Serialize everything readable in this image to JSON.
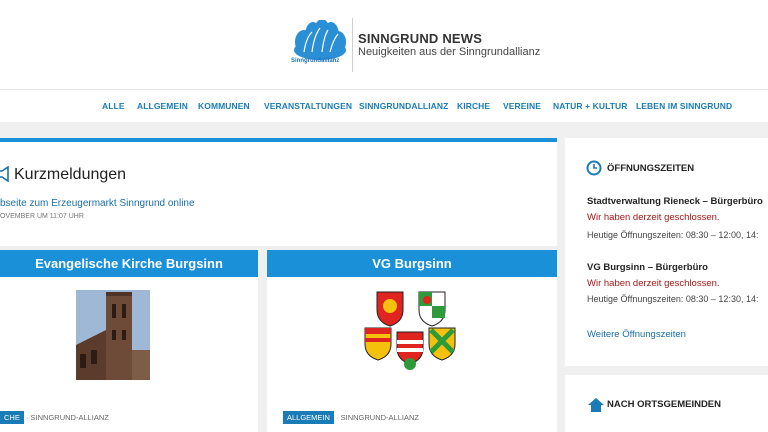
{
  "header": {
    "logo_text": "Sinngrundallianz",
    "title": "SINNGRUND NEWS",
    "subtitle": "Neuigkeiten aus der Sinngrundallianz"
  },
  "nav": {
    "items": [
      "ALLE",
      "ALLGEMEIN",
      "KOMMUNEN",
      "VERANSTALTUNGEN",
      "SINNGRUNDALLIANZ",
      "KIRCHE",
      "VEREINE",
      "NATUR + KULTUR",
      "LEBEN IM SINNGRUND"
    ]
  },
  "news": {
    "title": "Kurzmeldungen",
    "link": "bseite zum Erzeugermarkt Sinngrund online",
    "date": "OVEMBER UM 11:07 UHR"
  },
  "cards": [
    {
      "title": "Evangelische Kirche Burgsinn",
      "tag": "CHE",
      "category": "SINNGRUND-ALLIANZ"
    },
    {
      "title": "VG Burgsinn",
      "tag": "ALLGEMEIN",
      "category": "SINNGRUND-ALLIANZ"
    }
  ],
  "sidebar": {
    "hours_title": "ÖFFNUNGSZEITEN",
    "offices": [
      {
        "name": "Stadtverwaltung Rieneck – Bürgerbüro",
        "status": "Wir haben derzeit geschlossen.",
        "hours": "Heutige Öffnungszeiten: 08:30 – 12:00, 14:"
      },
      {
        "name": "VG Burgsinn – Bürgerbüro",
        "status": "Wir haben derzeit geschlossen.",
        "hours": "Heutige Öffnungszeiten: 08:30 – 12:30, 14:"
      }
    ],
    "more_link": "Weitere Öffnungszeiten",
    "places_title": "NACH ORTSGEMEINDEN"
  },
  "colors": {
    "accent": "#1a90d9",
    "link": "#1a6fa8",
    "closed": "#a01818"
  }
}
